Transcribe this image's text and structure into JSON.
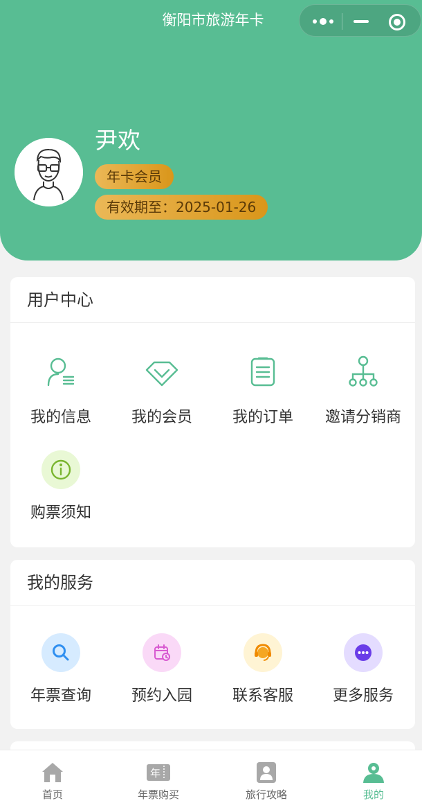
{
  "nav": {
    "title": "衡阳市旅游年卡"
  },
  "profile": {
    "name": "尹欢",
    "member_badge": "年卡会员",
    "expire_text": "有效期至：2025-01-26"
  },
  "user_center": {
    "title": "用户中心",
    "items": [
      {
        "label": "我的信息",
        "icon": "user-info-icon"
      },
      {
        "label": "我的会员",
        "icon": "diamond-icon"
      },
      {
        "label": "我的订单",
        "icon": "order-list-icon"
      },
      {
        "label": "邀请分销商",
        "icon": "network-icon"
      },
      {
        "label": "购票须知",
        "icon": "info-icon"
      }
    ]
  },
  "services": {
    "title": "我的服务",
    "items": [
      {
        "label": "年票查询",
        "icon": "search-icon",
        "bg": "#d6ebff"
      },
      {
        "label": "预约入园",
        "icon": "calendar-icon",
        "bg": "#fad9f7"
      },
      {
        "label": "联系客服",
        "icon": "customer-service-icon",
        "bg": "#fff4d4"
      },
      {
        "label": "更多服务",
        "icon": "more-icon",
        "bg": "#e4dcff"
      }
    ]
  },
  "tabbar": {
    "items": [
      {
        "label": "首页",
        "icon": "home-icon"
      },
      {
        "label": "年票购买",
        "icon": "ticket-icon"
      },
      {
        "label": "旅行攻略",
        "icon": "guide-icon"
      },
      {
        "label": "我的",
        "icon": "profile-icon"
      }
    ],
    "active_color": "#58bd93"
  },
  "colors": {
    "brand": "#58bd93",
    "badge": "#e3a73a"
  }
}
